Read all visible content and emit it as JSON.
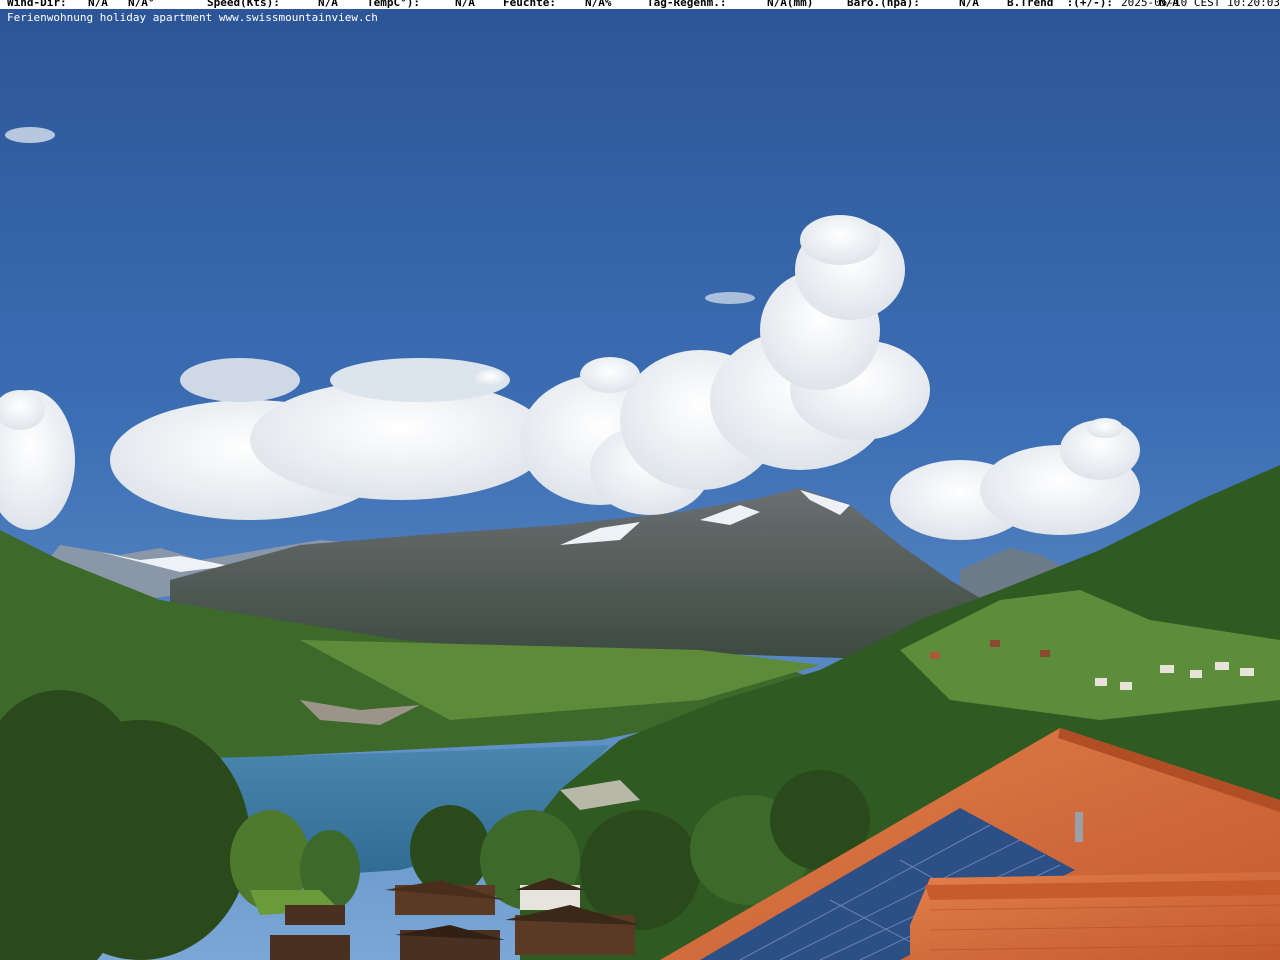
{
  "overlay": {
    "wind_dir_label": "Wind-Dir:",
    "wind_dir_value": "N/A",
    "wind_deg_value": "N/A°",
    "speed_label": "Speed(Kts):",
    "speed_value": "N/A",
    "temp_label": "TempC°):",
    "temp_value": "N/A",
    "humidity_label": "Feuchte:",
    "humidity_value": "N/A%",
    "rain_label": "Tag-Regenm.:",
    "rain_value": "N/A(mm)",
    "baro_label": "Baro.(hpa):",
    "baro_value": "N/A",
    "trend_label": "B.Trend  :(+/-):",
    "trend_value": "N/A",
    "caption": "Ferienwohnung holiday apartment www.swissmountainview.ch",
    "timestamp": "2025-05-10 CEST 10:20:03"
  },
  "colors": {
    "sky_top": "#2b5597",
    "sky_bottom": "#5f93cf",
    "cloud": "#f3f4f6",
    "mountain": "#5f6a72",
    "snow": "#eef2f7",
    "lake": "#3f7ea8",
    "forest": "#2f5a22",
    "roof": "#d8703e",
    "solar": "#2c4f85"
  }
}
